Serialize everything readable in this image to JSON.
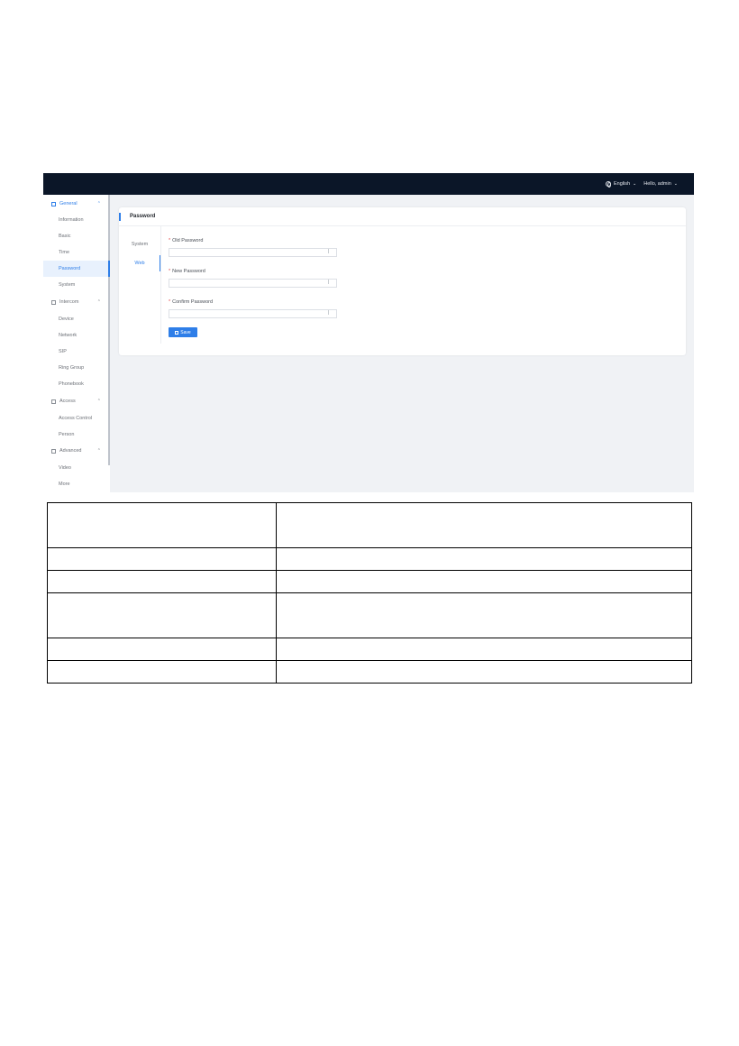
{
  "topbar": {
    "language": "English",
    "user": "Hello, admin"
  },
  "sidebar": {
    "groups": [
      {
        "label": "General",
        "icon": "grid-icon",
        "active": true,
        "items": [
          "Information",
          "Basic",
          "Time",
          "Password",
          "System"
        ]
      },
      {
        "label": "Intercom",
        "icon": "phone-icon",
        "active": false,
        "items": [
          "Device",
          "Network",
          "SIP",
          "Ring Group",
          "Phonebook"
        ]
      },
      {
        "label": "Access",
        "icon": "person-icon",
        "active": false,
        "items": [
          "Access Control",
          "Person"
        ]
      },
      {
        "label": "Advanced",
        "icon": "gear-icon",
        "active": false,
        "items": [
          "Video",
          "More"
        ]
      }
    ],
    "selected_item": "Password"
  },
  "card": {
    "title": "Password",
    "subtabs": [
      "System",
      "Web"
    ],
    "active_subtab": "Web",
    "fields": [
      {
        "label": "Old Password",
        "value": ""
      },
      {
        "label": "New Password",
        "value": ""
      },
      {
        "label": "Confirm Password",
        "value": ""
      }
    ],
    "save_label": "Save"
  },
  "colors": {
    "topbar": "#0b1628",
    "accent": "#2e7ee8",
    "content_bg": "#f0f2f5"
  }
}
